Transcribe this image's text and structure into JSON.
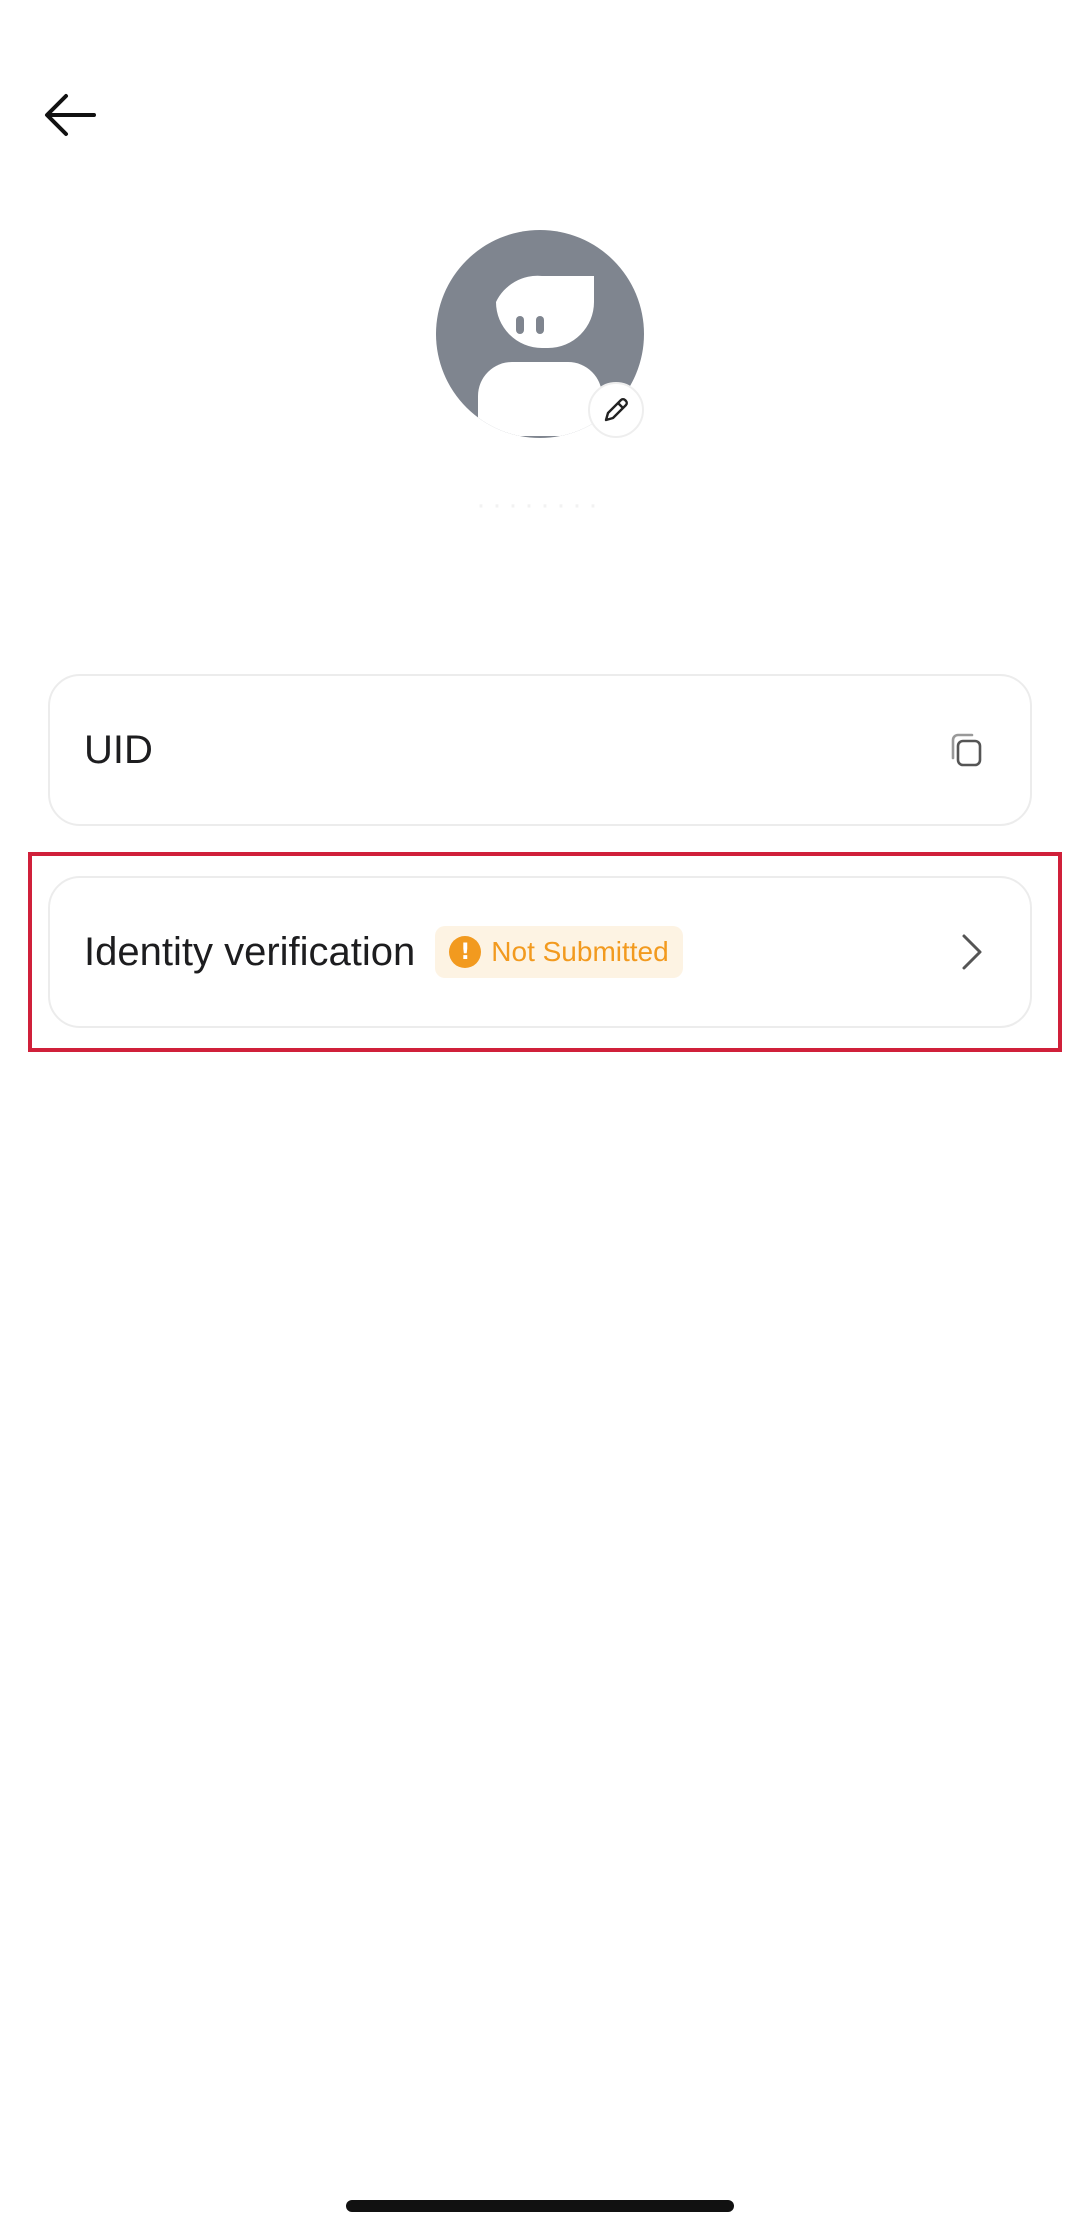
{
  "header": {
    "back_icon": "arrow-left-icon"
  },
  "profile": {
    "avatar_icon": "default-avatar",
    "edit_icon": "pencil-icon",
    "username": "········"
  },
  "uid_card": {
    "label": "UID",
    "value": "",
    "copy_icon": "copy-icon"
  },
  "identity_card": {
    "label": "Identity verification",
    "status": "Not Submitted",
    "status_icon": "warning-icon",
    "status_color": "#f29a1f",
    "status_bg": "#fdf3e3",
    "chevron_icon": "chevron-right-icon"
  },
  "colors": {
    "avatar_bg": "#7f858f",
    "highlight": "#d0203a"
  }
}
